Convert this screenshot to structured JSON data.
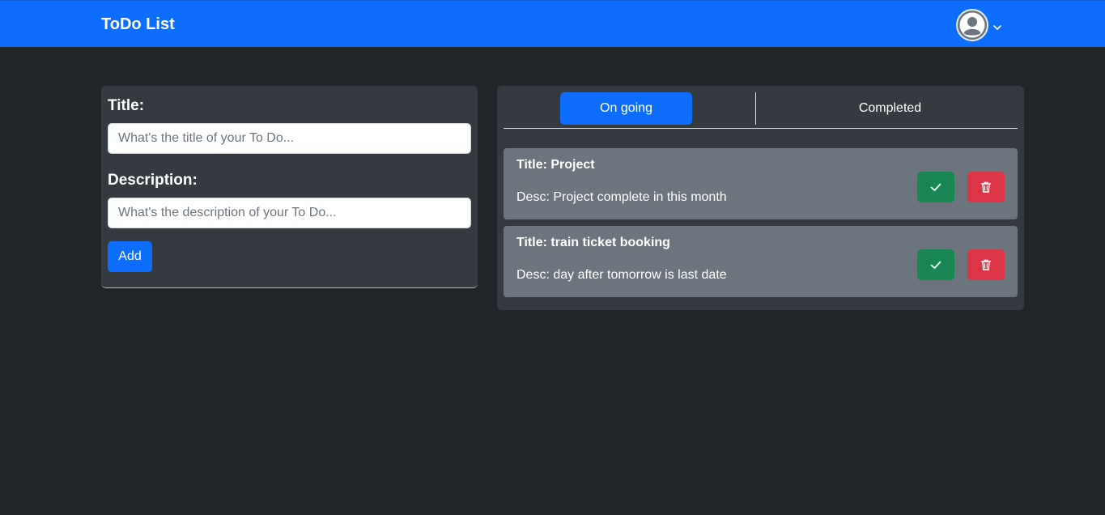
{
  "navbar": {
    "brand": "ToDo List",
    "profile_icon": "user-circle-icon",
    "dropdown_icon": "chevron-down-icon"
  },
  "form": {
    "title_label": "Title:",
    "title_placeholder": "What's the title of your To Do...",
    "title_value": "",
    "desc_label": "Description:",
    "desc_placeholder": "What's the description of your To Do...",
    "desc_value": "",
    "add_label": "Add"
  },
  "tabs": {
    "ongoing": "On going",
    "completed": "Completed",
    "active": "ongoing"
  },
  "todos": [
    {
      "title": "Title: Project",
      "desc": "Desc: Project complete in this month"
    },
    {
      "title": "Title: train ticket booking",
      "desc": "Desc: day after tomorrow is last date"
    }
  ],
  "colors": {
    "primary": "#0d6efd",
    "success": "#198754",
    "danger": "#dc3545",
    "background": "#212529",
    "card": "#343a40",
    "item": "#6c757d"
  },
  "icons": {
    "complete": "check-icon",
    "delete": "trash-icon"
  }
}
